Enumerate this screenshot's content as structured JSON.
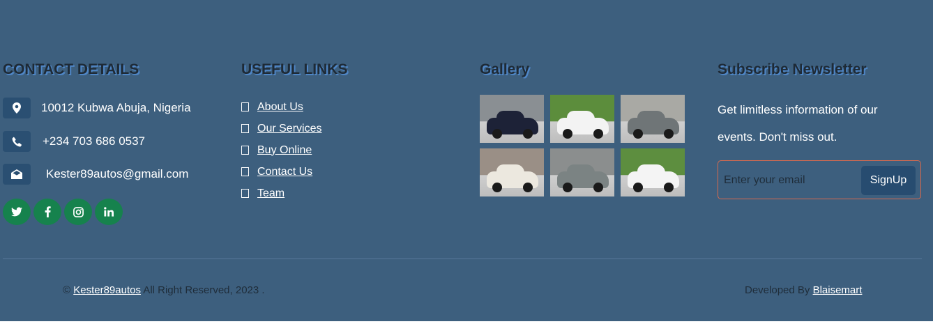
{
  "contact": {
    "heading": "CONTACT DETAILS",
    "address": "10012 Kubwa Abuja, Nigeria",
    "phone": "+234 703 686 0537",
    "email": "Kester89autos@gmail.com",
    "social": [
      {
        "icon": "twitter-icon",
        "glyph": "𝕥"
      },
      {
        "icon": "facebook-icon",
        "glyph": "f"
      },
      {
        "icon": "instagram-icon",
        "glyph": "◎"
      },
      {
        "icon": "linkedin-icon",
        "glyph": "in"
      }
    ]
  },
  "links": {
    "heading": "USEFUL LINKS",
    "items": [
      "About Us",
      "Our Services",
      "Buy Online",
      "Contact Us",
      "Team"
    ]
  },
  "gallery": {
    "heading": "Gallery",
    "images": [
      {
        "bg": "#8a8f93",
        "car": "#1d2237"
      },
      {
        "bg": "#5c8d3c",
        "car": "#f3f3f3"
      },
      {
        "bg": "#a9a9a4",
        "car": "#6f7577"
      },
      {
        "bg": "#9a8f86",
        "car": "#ece8df"
      },
      {
        "bg": "#8b8e8e",
        "car": "#7b8383"
      },
      {
        "bg": "#5d8e3f",
        "car": "#f4f4f4"
      }
    ]
  },
  "newsletter": {
    "heading": "Subscribe Newsletter",
    "text": "Get limitless information of our events. Don't miss out.",
    "placeholder": "Enter your email",
    "button": "SignUp"
  },
  "footer": {
    "copy_symbol": "©",
    "brand": "Kester89autos",
    "rights": " All Right Reserved, 2023 .",
    "developed_by": "Developed By ",
    "developer": "Blaisemart"
  },
  "colors": {
    "background": "#3d5f7e",
    "icon_box": "#2a4f72",
    "social": "#16824d",
    "accent_border": "#d86a4e"
  }
}
